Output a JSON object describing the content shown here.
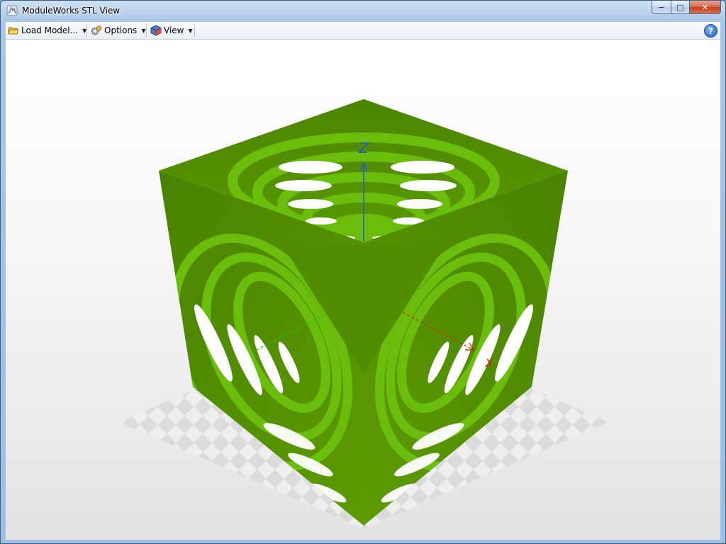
{
  "window": {
    "title": "ModuleWorks STL View",
    "controls": {
      "minimize": "−",
      "maximize": "□",
      "close": "✕"
    }
  },
  "toolbar": {
    "items": [
      {
        "label": "Load Model...",
        "icon": "folder-open-icon"
      },
      {
        "label": "Options",
        "icon": "gears-icon"
      },
      {
        "label": "View",
        "icon": "cube-view-icon"
      }
    ],
    "help": "?"
  },
  "viewport": {
    "model_color": "#4f8a00",
    "axes": {
      "z": "Z",
      "x": "X",
      "z_color": "#1f5fcc",
      "x_color": "#cc2200",
      "y_color": "#1cbd2a"
    }
  }
}
